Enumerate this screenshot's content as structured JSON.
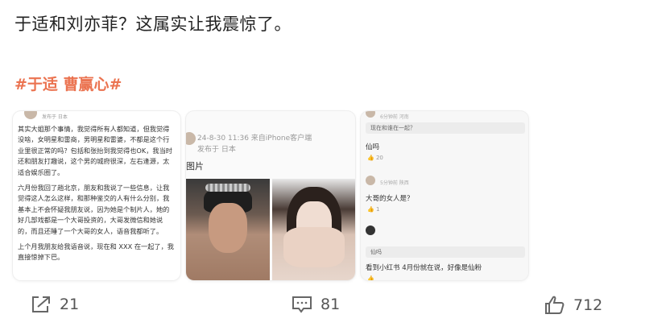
{
  "post": {
    "text": "于适和刘亦菲？这属实让我震惊了。",
    "hashtag": "#于适 曹赢心#"
  },
  "card1": {
    "meta": "发布于 日本",
    "paragraphs": [
      "其实大姐那个事情，我觉得所有人都知道，但我觉得没啥，女明星和雷商，男明星和雷婆，不都是这个行业里很正常的吗？包括和张抬到我觉得也OK，我当时还和朋友打趣说，这个男的城府很深，左右逢源，太适合娱乐圈了。",
      "六月份我回了趟北京，朋友和我说了一些信息，让我觉得这人怎么这样，和那种鉴交的人有什么分别，我基本上不会怀疑我朋友说，因为她是个制片人，她的好几部戏都是一个大哥投资的，大哥发微信和她说的，而且还睡了一个大哥的女人，语音我都听了。",
      "上个月我朋友给我语音说，现在和 XXX 在一起了，我直接惊掉下巴。"
    ]
  },
  "card2": {
    "time": "24-8-30 11:36  来自iPhone客户端",
    "location": "发布于 日本",
    "label": "图片"
  },
  "card3": {
    "top_meta": "6分钟前 河南",
    "q1": "现在和谁在一起？",
    "r1": "仙吗",
    "l1": "20",
    "meta2": "5分钟前 陕西",
    "r2": "大哥的女人是？",
    "l2": "1",
    "meta3": "",
    "b3": "仙吗",
    "r3": "看到小红书 4月份就在说，好像是仙粉",
    "l3": ""
  },
  "actions": {
    "share_count": "21",
    "comment_count": "81",
    "like_count": "712"
  },
  "colors": {
    "hashtag": "#eb7350",
    "text": "#222222",
    "icon": "#666666"
  },
  "icons": [
    "share-icon",
    "comment-icon",
    "like-icon"
  ]
}
